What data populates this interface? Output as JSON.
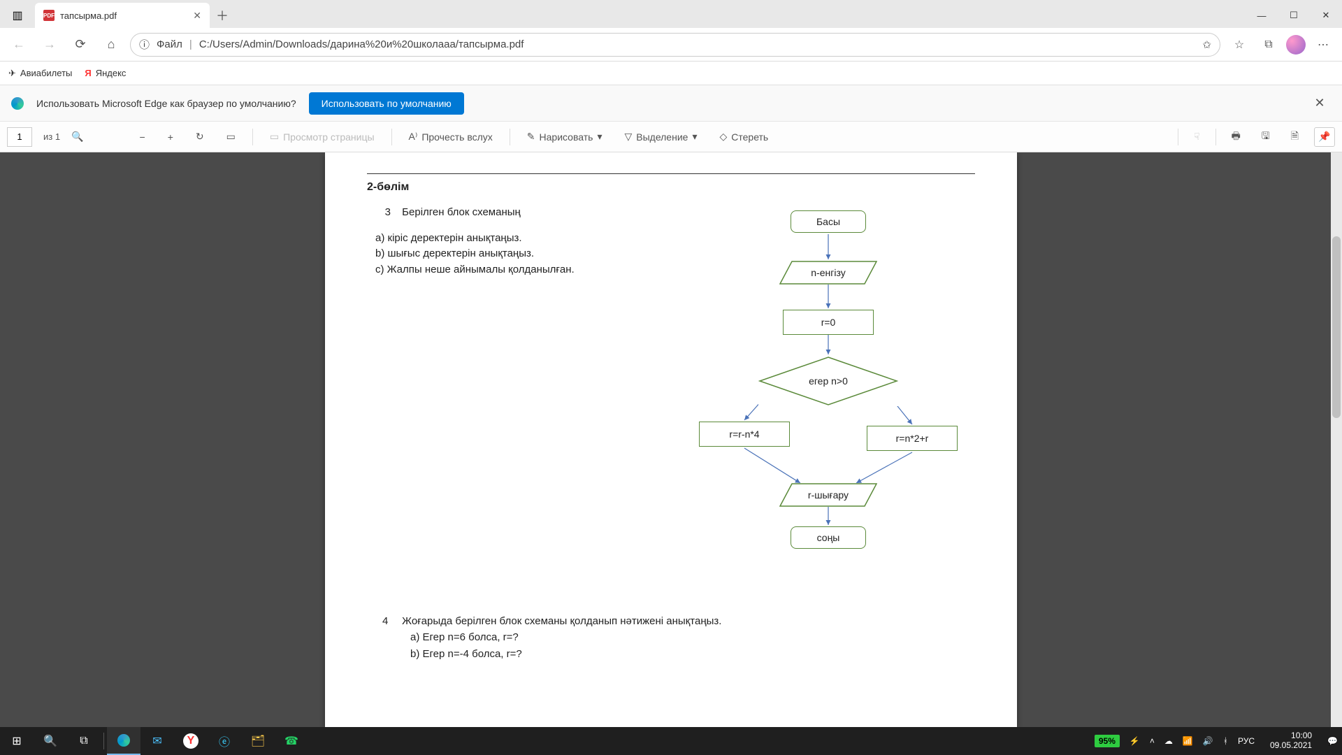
{
  "tab": {
    "title": "тапсырма.pdf"
  },
  "url": {
    "scheme_label": "Файл",
    "path": "C:/Users/Admin/Downloads/дарина%20и%20школааа/тапсырма.pdf"
  },
  "bookmarks": [
    {
      "label": "Авиабилеты"
    },
    {
      "label": "Яндекс"
    }
  ],
  "prompt": {
    "text": "Использовать Microsoft Edge как браузер по умолчанию?",
    "button": "Использовать по умолчанию"
  },
  "pdfbar": {
    "page": "1",
    "of": "из 1",
    "page_view": "Просмотр страницы",
    "read_aloud": "Прочесть вслух",
    "draw": "Нарисовать",
    "highlight": "Выделение",
    "erase": "Стереть"
  },
  "doc": {
    "section": "2-бөлім",
    "q3_num": "3",
    "q3_title": "Берілген блок схеманың",
    "q3_a": "a) кіріс деректерін анықтаңыз.",
    "q3_b": "b) шығыс деректерін анықтаңыз.",
    "q3_c": "c) Жалпы неше айнымалы қолданылған.",
    "flow": {
      "start": "Басы",
      "input": "n-енгізу",
      "init": "r=0",
      "cond": "егер n>0",
      "left": "r=r-n*4",
      "right": "r=n*2+r",
      "output": "r-шығару",
      "end": "соңы"
    },
    "q4_num": "4",
    "q4_title": "Жоғарыда берілген блок схеманы қолданып нәтижені анықтаңыз.",
    "q4_a": "a)   Егер n=6 болса, r=?",
    "q4_b": "b)   Егер n=-4 болса, r=?"
  },
  "tray": {
    "battery": "95%",
    "lang": "РУС",
    "time": "10:00",
    "date": "09.05.2021"
  },
  "chart_data": {
    "type": "table",
    "description": "Flowchart",
    "nodes": [
      {
        "id": "start",
        "type": "terminator",
        "label": "Басы"
      },
      {
        "id": "in",
        "type": "io",
        "label": "n-енгізу"
      },
      {
        "id": "init",
        "type": "process",
        "label": "r=0"
      },
      {
        "id": "cond",
        "type": "decision",
        "label": "егер n>0"
      },
      {
        "id": "pL",
        "type": "process",
        "label": "r=r-n*4"
      },
      {
        "id": "pR",
        "type": "process",
        "label": "r=n*2+r"
      },
      {
        "id": "out",
        "type": "io",
        "label": "r-шығару"
      },
      {
        "id": "end",
        "type": "terminator",
        "label": "соңы"
      }
    ],
    "edges": [
      [
        "start",
        "in"
      ],
      [
        "in",
        "init"
      ],
      [
        "init",
        "cond"
      ],
      [
        "cond",
        "pL"
      ],
      [
        "cond",
        "pR"
      ],
      [
        "pL",
        "out"
      ],
      [
        "pR",
        "out"
      ],
      [
        "out",
        "end"
      ]
    ]
  }
}
